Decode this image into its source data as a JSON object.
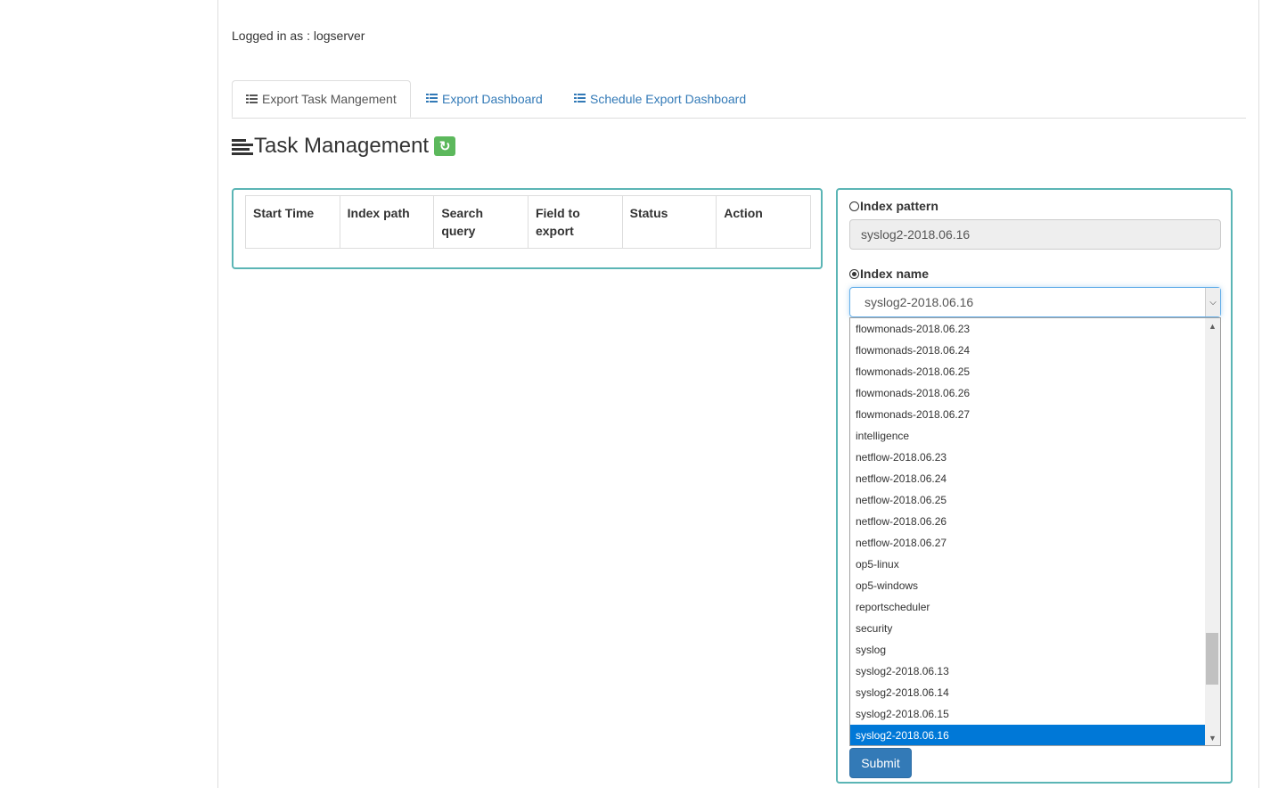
{
  "user": {
    "logged_in_text": "Logged in as : logserver"
  },
  "tabs": [
    {
      "label": "Export Task Mangement",
      "icon": "list-icon",
      "active": true
    },
    {
      "label": "Export Dashboard",
      "icon": "list-icon",
      "active": false
    },
    {
      "label": "Schedule Export Dashboard",
      "icon": "list-icon",
      "active": false
    }
  ],
  "page": {
    "title": "Task Management",
    "title_icon": "align-left-icon",
    "refresh_icon": "refresh-icon"
  },
  "task_table": {
    "columns": [
      "Start Time",
      "Index path",
      "Search query",
      "Field to export",
      "Status",
      "Action"
    ],
    "rows": []
  },
  "export_form": {
    "index_pattern_label": "Index pattern",
    "index_pattern_value": "syslog2-2018.06.16",
    "index_name_label": "Index name",
    "index_name_selected": "syslog2-2018.06.16",
    "options": [
      "flowmonads-2018.06.23",
      "flowmonads-2018.06.24",
      "flowmonads-2018.06.25",
      "flowmonads-2018.06.26",
      "flowmonads-2018.06.27",
      "intelligence",
      "netflow-2018.06.23",
      "netflow-2018.06.24",
      "netflow-2018.06.25",
      "netflow-2018.06.26",
      "netflow-2018.06.27",
      "op5-linux",
      "op5-windows",
      "reportscheduler",
      "security",
      "syslog",
      "syslog2-2018.06.13",
      "syslog2-2018.06.14",
      "syslog2-2018.06.15",
      "syslog2-2018.06.16"
    ],
    "submit_label": "Submit"
  },
  "colors": {
    "accent": "#337ab7",
    "panel_border": "#5bb5b5",
    "refresh_bg": "#5cb85c",
    "selected_option": "#0078d7"
  }
}
